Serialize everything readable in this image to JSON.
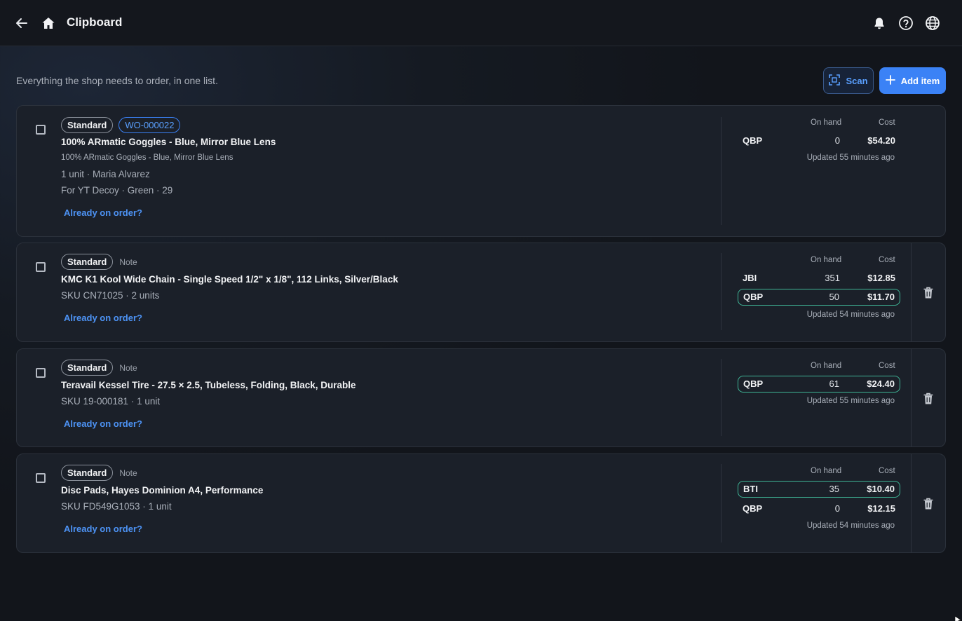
{
  "header": {
    "title": "Clipboard",
    "icons": [
      "back-arrow-icon",
      "home-icon",
      "bell-icon",
      "help-icon",
      "globe-icon"
    ]
  },
  "page": {
    "subtitle": "Everything the shop needs to order, in one list.",
    "scan_label": "Scan",
    "add_label": "Add item"
  },
  "columns": {
    "on_hand": "On hand",
    "cost": "Cost"
  },
  "items": [
    {
      "badge": "Standard",
      "work_order": "WO-000022",
      "name": "100% ARmatic Goggles - Blue, Mirror Blue Lens",
      "subname": "100% ARmatic Goggles - Blue, Mirror Blue Lens",
      "meta": "1 unit · Maria Alvarez",
      "meta2": "For YT Decoy · Green · 29",
      "link": "Already on order?",
      "vendors": [
        {
          "name": "QBP",
          "on_hand": "0",
          "cost": "$54.20",
          "selected": false
        }
      ],
      "updated": "Updated 55 minutes ago"
    },
    {
      "badge": "Standard",
      "note": "Note",
      "name": "KMC K1 Kool Wide Chain - Single Speed 1/2\" x 1/8\", 112 Links, Silver/Black",
      "meta": "SKU CN71025 · 2 units",
      "link": "Already on order?",
      "vendors": [
        {
          "name": "JBI",
          "on_hand": "351",
          "cost": "$12.85",
          "selected": false
        },
        {
          "name": "QBP",
          "on_hand": "50",
          "cost": "$11.70",
          "selected": true
        }
      ],
      "updated": "Updated 54 minutes ago"
    },
    {
      "badge": "Standard",
      "note": "Note",
      "name": "Teravail Kessel Tire - 27.5 × 2.5, Tubeless, Folding, Black, Durable",
      "meta": "SKU 19-000181 · 1 unit",
      "link": "Already on order?",
      "vendors": [
        {
          "name": "QBP",
          "on_hand": "61",
          "cost": "$24.40",
          "selected": true
        }
      ],
      "updated": "Updated 55 minutes ago"
    },
    {
      "badge": "Standard",
      "note": "Note",
      "name": "Disc Pads, Hayes Dominion A4, Performance",
      "meta": "SKU FD549G1053 · 1 unit",
      "link": "Already on order?",
      "vendors": [
        {
          "name": "BTI",
          "on_hand": "35",
          "cost": "$10.40",
          "selected": true
        },
        {
          "name": "QBP",
          "on_hand": "0",
          "cost": "$12.15",
          "selected": false
        }
      ],
      "updated": "Updated 54 minutes ago"
    }
  ],
  "colors": {
    "accent": "#3b82f6",
    "link": "#4d93f5",
    "selected_vendor": "#3fb596",
    "card_bg": "#1b2029"
  }
}
